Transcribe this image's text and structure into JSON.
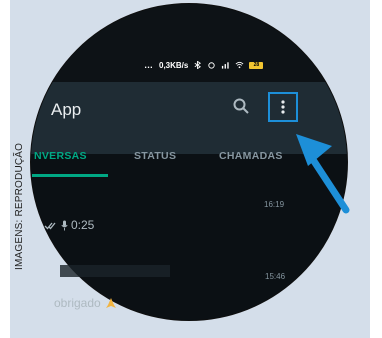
{
  "credit": "IMAGENS: REPRODUÇÃO",
  "status_bar": {
    "dots": "…",
    "speed": "0,3KB/s",
    "battery": "28"
  },
  "app_bar": {
    "title": "App"
  },
  "tabs": [
    {
      "label": "NVERSAS"
    },
    {
      "label": "STATUS"
    },
    {
      "label": "CHAMADAS"
    }
  ],
  "chats": [
    {
      "time": "16:19",
      "preview": "0:25"
    },
    {
      "time": "15:46",
      "preview": "obrigado"
    }
  ],
  "colors": {
    "accent": "#00a884",
    "highlight": "#1d8fd8",
    "panel": "#d4deea"
  }
}
